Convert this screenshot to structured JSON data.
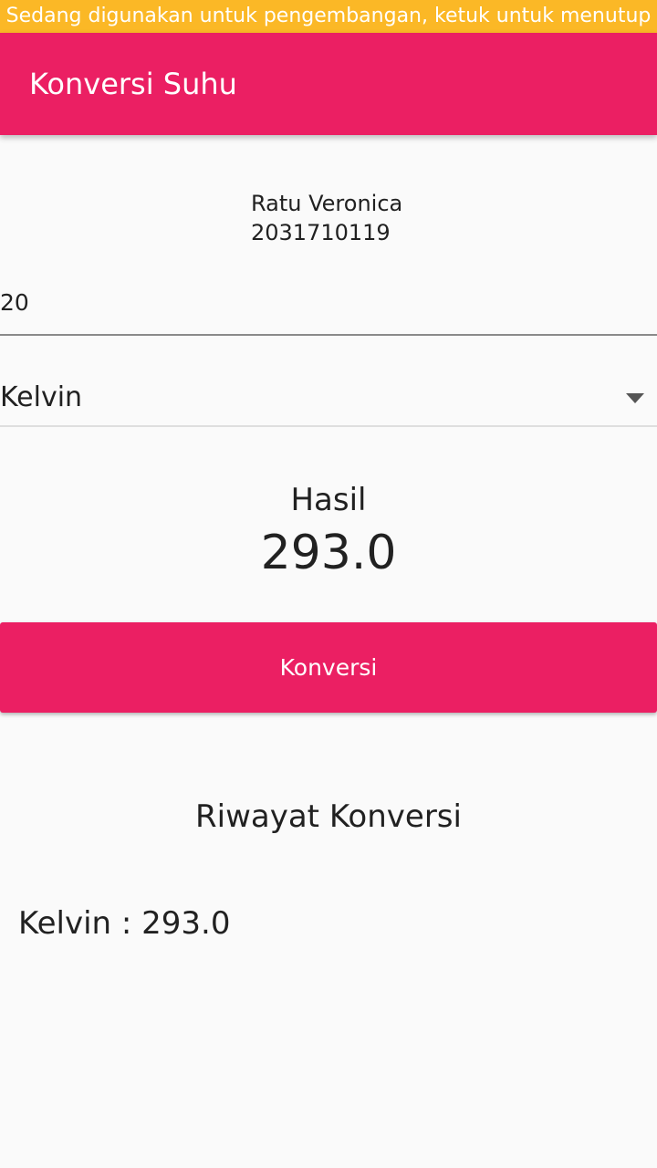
{
  "dev_banner": {
    "text": "Sedang digunakan untuk pengembangan, ketuk untuk menutup"
  },
  "app_bar": {
    "title": "Konversi Suhu"
  },
  "student": {
    "name": "Ratu Veronica",
    "id": "2031710119"
  },
  "input": {
    "value": "20",
    "placeholder": ""
  },
  "unit_select": {
    "selected": "Kelvin"
  },
  "result": {
    "label": "Hasil",
    "value": "293.0"
  },
  "convert_button": {
    "label": "Konversi"
  },
  "history": {
    "title": "Riwayat Konversi",
    "items": [
      "Kelvin : 293.0"
    ]
  },
  "colors": {
    "primary": "#eb1f63",
    "banner": "#fbb826",
    "background": "#fafafa"
  },
  "icons": {
    "dropdown": "dropdown-caret-icon"
  }
}
